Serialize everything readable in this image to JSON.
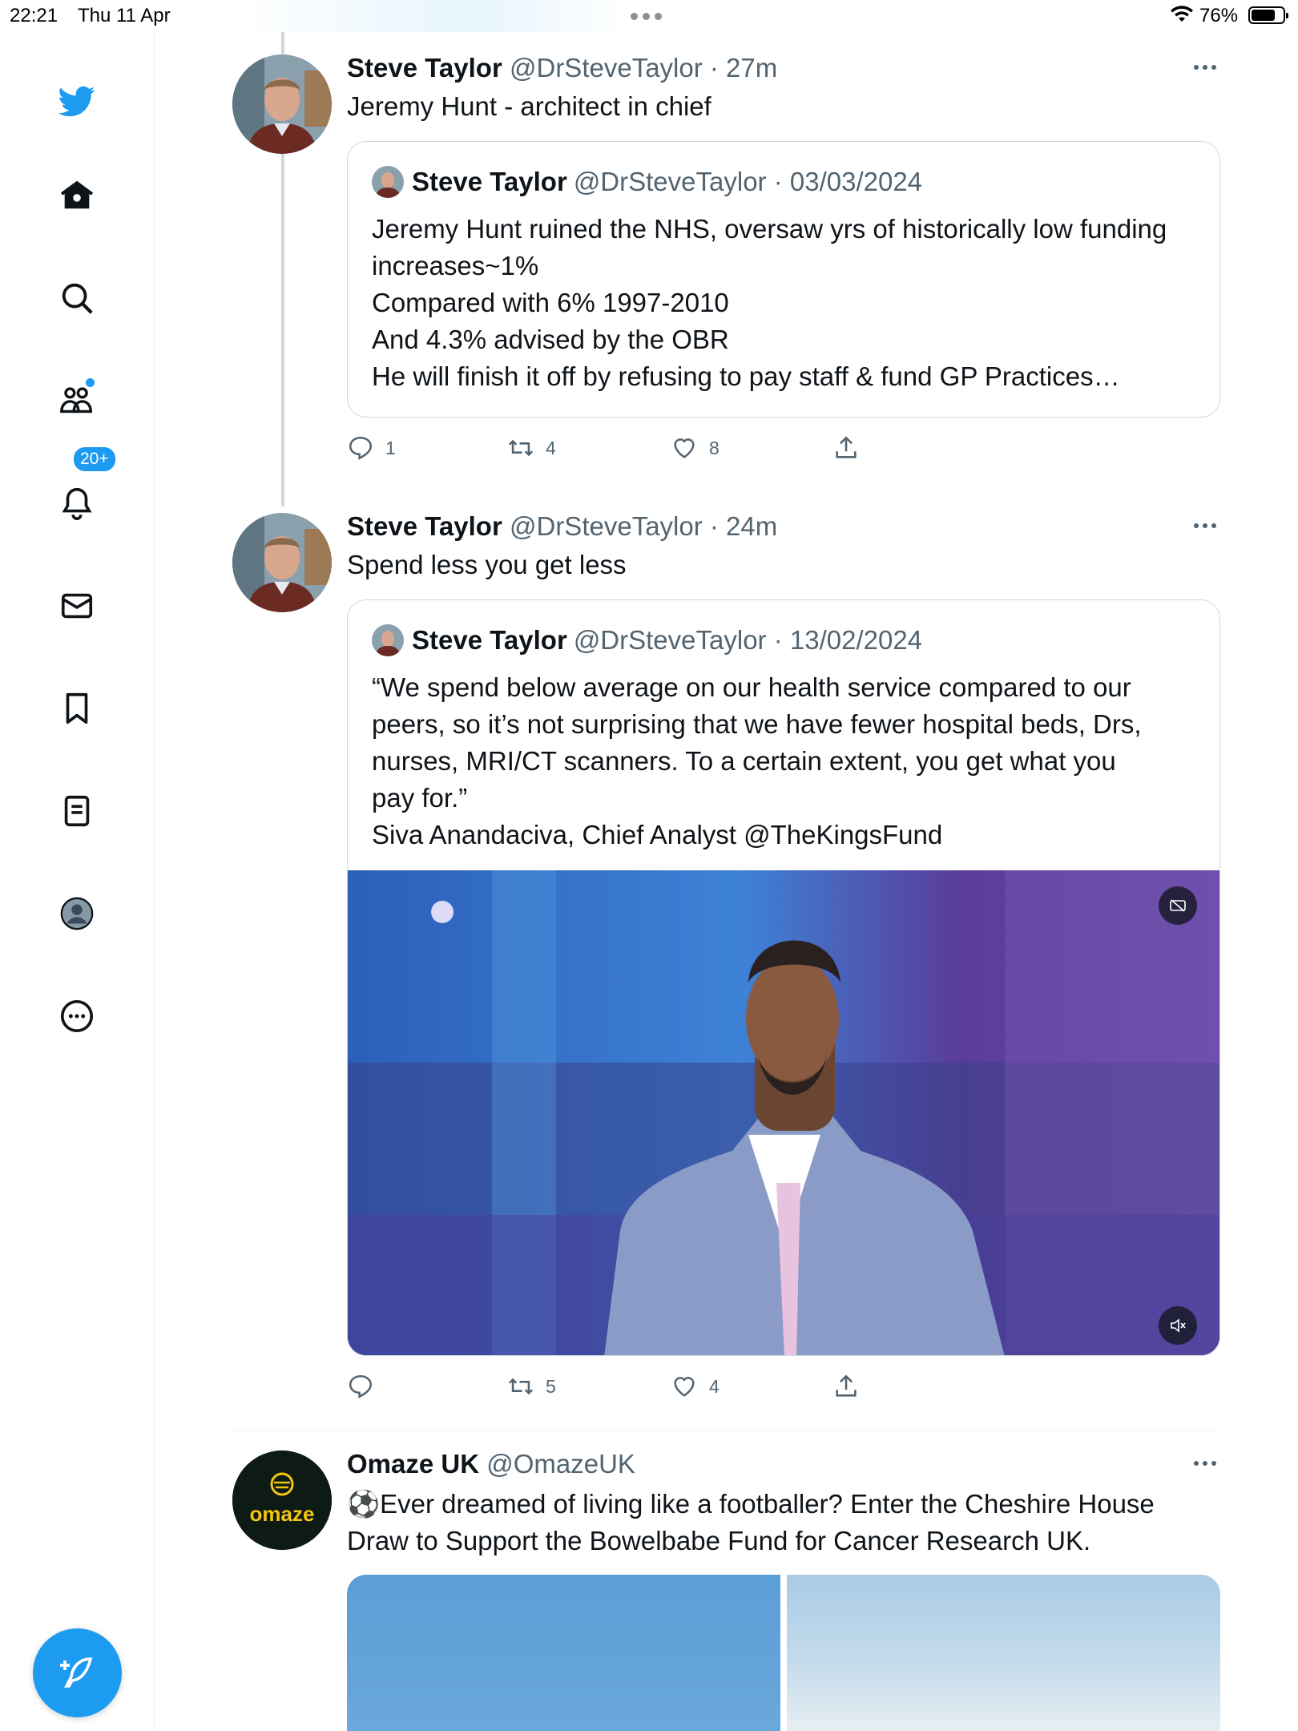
{
  "status_bar": {
    "time": "22:21",
    "date": "Thu 11 Apr",
    "battery": "76%",
    "battery_level": 0.76
  },
  "sidebar": {
    "items": [
      "twitter-logo",
      "home",
      "search",
      "communities",
      "notifications",
      "messages",
      "bookmarks",
      "lists",
      "profile",
      "more"
    ],
    "notification_badge": "20+"
  },
  "tweets": [
    {
      "name": "Steve Taylor",
      "meta": "@DrSteveTaylor · 27m",
      "text": "Jeremy Hunt - architect in chief",
      "quote": {
        "name": "Steve Taylor",
        "meta": "@DrSteveTaylor · 03/03/2024",
        "lines": [
          "Jeremy Hunt ruined the NHS, oversaw yrs of historically low funding",
          "increases~1%",
          "Compared with 6% 1997-2010",
          "And 4.3% advised by the OBR",
          "He will finish it off by refusing to pay staff & fund GP Practices…"
        ]
      },
      "replies": "1",
      "retweets": "4",
      "likes": "8"
    },
    {
      "name": "Steve Taylor",
      "meta": "@DrSteveTaylor · 24m",
      "text": "Spend less you get less",
      "quote": {
        "name": "Steve Taylor",
        "meta": "@DrSteveTaylor · 13/02/2024",
        "lines": [
          "“We spend below average on our health service compared to our",
          "peers, so it’s not surprising that we have fewer hospital beds, Drs,",
          "nurses, MRI/CT scanners. To a certain extent, you get what you",
          "pay for.”",
          "Siva Anandaciva, Chief Analyst @TheKingsFund"
        ]
      },
      "replies": "",
      "retweets": "5",
      "likes": "4"
    },
    {
      "name": "Omaze UK",
      "meta": "@OmazeUK",
      "avatar_text": "omaze",
      "lines": [
        "⚽Ever dreamed of living like a footballer? Enter the Cheshire House",
        "Draw to Support the Bowelbabe Fund for Cancer Research UK."
      ]
    }
  ],
  "colors": {
    "accent": "#1d9bf0",
    "text": "#0f1419",
    "secondary": "#536471",
    "border": "#cfd9de",
    "omaze_yellow": "#f2c511"
  }
}
